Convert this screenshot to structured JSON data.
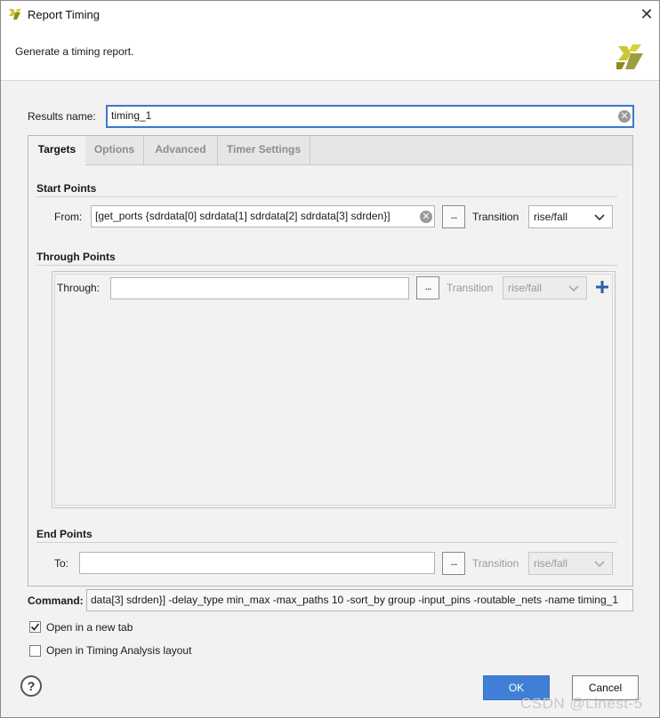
{
  "window": {
    "title": "Report Timing",
    "header_text": "Generate a timing report."
  },
  "results": {
    "label": "Results name:",
    "value": "timing_1"
  },
  "tabs": [
    {
      "label": "Targets",
      "active": true
    },
    {
      "label": "Options",
      "active": false
    },
    {
      "label": "Advanced",
      "active": false
    },
    {
      "label": "Timer Settings",
      "active": false
    }
  ],
  "start_points": {
    "title": "Start Points",
    "from_label": "From:",
    "from_value": "[get_ports {sdrdata[0] sdrdata[1] sdrdata[2] sdrdata[3] sdrden}]",
    "browse_label": "...",
    "transition_label": "Transition",
    "transition_value": "rise/fall"
  },
  "through_points": {
    "title": "Through Points",
    "through_label": "Through:",
    "through_value": "",
    "browse_label": "...",
    "transition_label": "Transition",
    "transition_value": "rise/fall",
    "add_label": "+"
  },
  "end_points": {
    "title": "End Points",
    "to_label": "To:",
    "to_value": "",
    "browse_label": "...",
    "transition_label": "Transition",
    "transition_value": "rise/fall"
  },
  "command": {
    "label": "Command:",
    "value": "data[3] sdrden}] -delay_type min_max -max_paths 10 -sort_by group -input_pins -routable_nets -name timing_1"
  },
  "options": {
    "open_new_tab_label": "Open in a new tab",
    "open_new_tab_checked": true,
    "open_timing_layout_label": "Open in Timing Analysis layout",
    "open_timing_layout_checked": false
  },
  "buttons": {
    "help_label": "?",
    "ok_label": "OK",
    "cancel_label": "Cancel"
  },
  "watermark": "CSDN @Linest-5",
  "colors": {
    "accent": "#3f7fd5",
    "logo_yellow": "#c8c832",
    "logo_olive": "#8c8c1e",
    "disabled_text": "#9a9a9a"
  },
  "icons": [
    "app-logo-icon",
    "close-icon",
    "clear-icon",
    "chevron-down-icon",
    "plus-icon",
    "help-icon",
    "checkmark-icon"
  ]
}
